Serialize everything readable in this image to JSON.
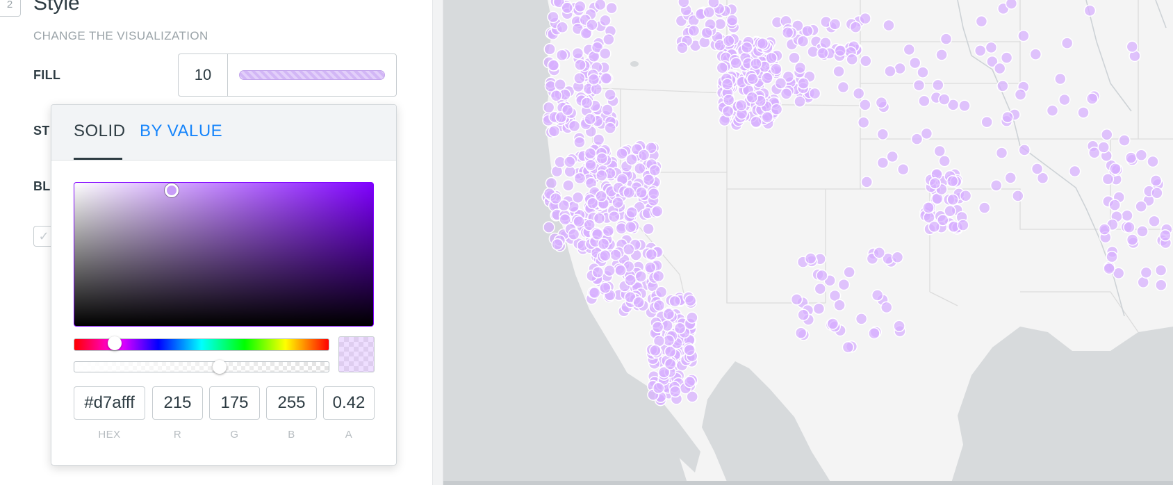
{
  "section": {
    "step_number": "2",
    "title": "Style",
    "subtitle": "CHANGE THE VISUALIZATION"
  },
  "rows": {
    "fill_label": "FILL",
    "fill_size": "10",
    "stroke_label_partial": "ST",
    "blend_label_partial": "BL"
  },
  "color_picker": {
    "tabs": {
      "solid": "SOLID",
      "by_value": "BY VALUE",
      "active": "SOLID"
    },
    "hex": "#d7afff",
    "r": "215",
    "g": "175",
    "b": "255",
    "a": "0.42",
    "labels": {
      "hex": "HEX",
      "r": "R",
      "g": "G",
      "b": "B",
      "a": "A"
    },
    "base_hue_color": "#7f00ff",
    "accent_color": "#1785fb"
  },
  "map": {
    "point_color": "#d7afff",
    "point_opacity": 0.42,
    "land_color": "#f4f4f4",
    "water_color": "#d7dadc"
  }
}
